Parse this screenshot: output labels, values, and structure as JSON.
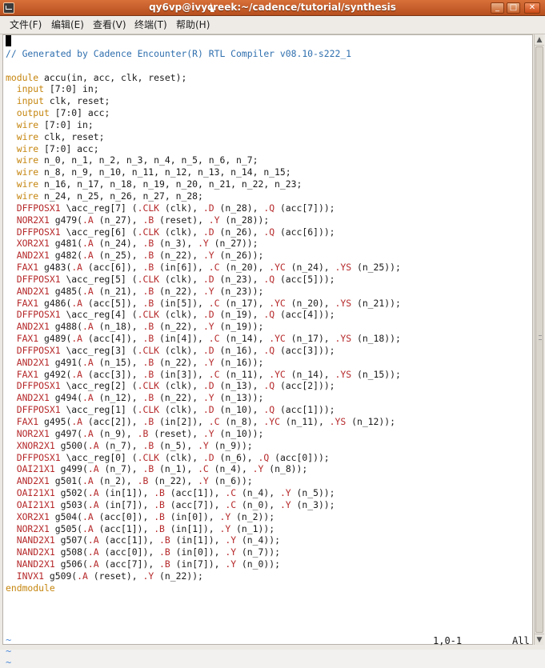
{
  "window": {
    "title": "qy6vp@ivycreek:~/cadence/tutorial/synthesis",
    "buttons": {
      "minimize": "_",
      "maximize": "□",
      "close": "✕"
    }
  },
  "menubar": {
    "items": [
      "文件(F)",
      "编辑(E)",
      "查看(V)",
      "终端(T)",
      "帮助(H)"
    ]
  },
  "editor": {
    "lines": [
      "",
      "// Generated by Cadence Encounter(R) RTL Compiler v08.10-s222_1",
      "",
      "module accu(in, acc, clk, reset);",
      "  input [7:0] in;",
      "  input clk, reset;",
      "  output [7:0] acc;",
      "  wire [7:0] in;",
      "  wire clk, reset;",
      "  wire [7:0] acc;",
      "  wire n_0, n_1, n_2, n_3, n_4, n_5, n_6, n_7;",
      "  wire n_8, n_9, n_10, n_11, n_12, n_13, n_14, n_15;",
      "  wire n_16, n_17, n_18, n_19, n_20, n_21, n_22, n_23;",
      "  wire n_24, n_25, n_26, n_27, n_28;",
      "  DFFPOSX1 \\acc_reg[7] (.CLK (clk), .D (n_28), .Q (acc[7]));",
      "  NOR2X1 g479(.A (n_27), .B (reset), .Y (n_28));",
      "  DFFPOSX1 \\acc_reg[6] (.CLK (clk), .D (n_26), .Q (acc[6]));",
      "  XOR2X1 g481(.A (n_24), .B (n_3), .Y (n_27));",
      "  AND2X1 g482(.A (n_25), .B (n_22), .Y (n_26));",
      "  FAX1 g483(.A (acc[6]), .B (in[6]), .C (n_20), .YC (n_24), .YS (n_25));",
      "  DFFPOSX1 \\acc_reg[5] (.CLK (clk), .D (n_23), .Q (acc[5]));",
      "  AND2X1 g485(.A (n_21), .B (n_22), .Y (n_23));",
      "  FAX1 g486(.A (acc[5]), .B (in[5]), .C (n_17), .YC (n_20), .YS (n_21));",
      "  DFFPOSX1 \\acc_reg[4] (.CLK (clk), .D (n_19), .Q (acc[4]));",
      "  AND2X1 g488(.A (n_18), .B (n_22), .Y (n_19));",
      "  FAX1 g489(.A (acc[4]), .B (in[4]), .C (n_14), .YC (n_17), .YS (n_18));",
      "  DFFPOSX1 \\acc_reg[3] (.CLK (clk), .D (n_16), .Q (acc[3]));",
      "  AND2X1 g491(.A (n_15), .B (n_22), .Y (n_16));",
      "  FAX1 g492(.A (acc[3]), .B (in[3]), .C (n_11), .YC (n_14), .YS (n_15));",
      "  DFFPOSX1 \\acc_reg[2] (.CLK (clk), .D (n_13), .Q (acc[2]));",
      "  AND2X1 g494(.A (n_12), .B (n_22), .Y (n_13));",
      "  DFFPOSX1 \\acc_reg[1] (.CLK (clk), .D (n_10), .Q (acc[1]));",
      "  FAX1 g495(.A (acc[2]), .B (in[2]), .C (n_8), .YC (n_11), .YS (n_12));",
      "  NOR2X1 g497(.A (n_9), .B (reset), .Y (n_10));",
      "  XNOR2X1 g500(.A (n_7), .B (n_5), .Y (n_9));",
      "  DFFPOSX1 \\acc_reg[0] (.CLK (clk), .D (n_6), .Q (acc[0]));",
      "  OAI21X1 g499(.A (n_7), .B (n_1), .C (n_4), .Y (n_8));",
      "  AND2X1 g501(.A (n_2), .B (n_22), .Y (n_6));",
      "  OAI21X1 g502(.A (in[1]), .B (acc[1]), .C (n_4), .Y (n_5));",
      "  OAI21X1 g503(.A (in[7]), .B (acc[7]), .C (n_0), .Y (n_3));",
      "  XOR2X1 g504(.A (acc[0]), .B (in[0]), .Y (n_2));",
      "  NOR2X1 g505(.A (acc[1]), .B (in[1]), .Y (n_1));",
      "  NAND2X1 g507(.A (acc[1]), .B (in[1]), .Y (n_4));",
      "  NAND2X1 g508(.A (acc[0]), .B (in[0]), .Y (n_7));",
      "  NAND2X1 g506(.A (acc[7]), .B (in[7]), .Y (n_0));",
      "  INVX1 g509(.A (reset), .Y (n_22));",
      "endmodule"
    ],
    "tildes": [
      "~",
      "~",
      "~"
    ]
  },
  "status": {
    "position": "1,0-1",
    "percent": "All"
  },
  "colors": {
    "titlebar": "#c85c28",
    "comment": "#2f6fae",
    "keyword": "#c5850e",
    "cell": "#b6282a",
    "tilde": "#4f8ad8"
  }
}
